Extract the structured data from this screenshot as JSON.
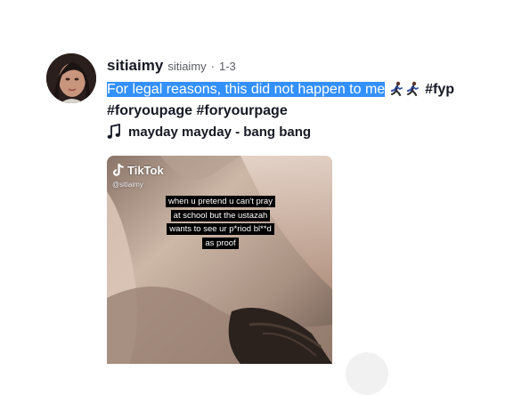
{
  "post": {
    "author_name": "sitiaimy",
    "author_handle": "sitiaimy",
    "separator": "·",
    "date": "1-3",
    "caption_selected": "For legal reasons, this did not happen to me",
    "caption_emojis": [
      "running-woman-emoji",
      "running-woman-emoji"
    ],
    "hashtags": [
      "#fyp",
      "#foryoupage",
      "#foryourpage"
    ],
    "music_icon": "music-note-icon",
    "music": "mayday mayday - bang bang"
  },
  "video": {
    "watermark_brand": "TikTok",
    "watermark_handle": "@sitiaimy",
    "overlay_text": "when u pretend u can't pray at school but the ustazah wants to see ur p*riod bl**d as proof"
  },
  "colors": {
    "selection": "#3390ff",
    "text": "#161823",
    "muted": "#5c5d66",
    "button_bg": "#f1f1f2"
  }
}
